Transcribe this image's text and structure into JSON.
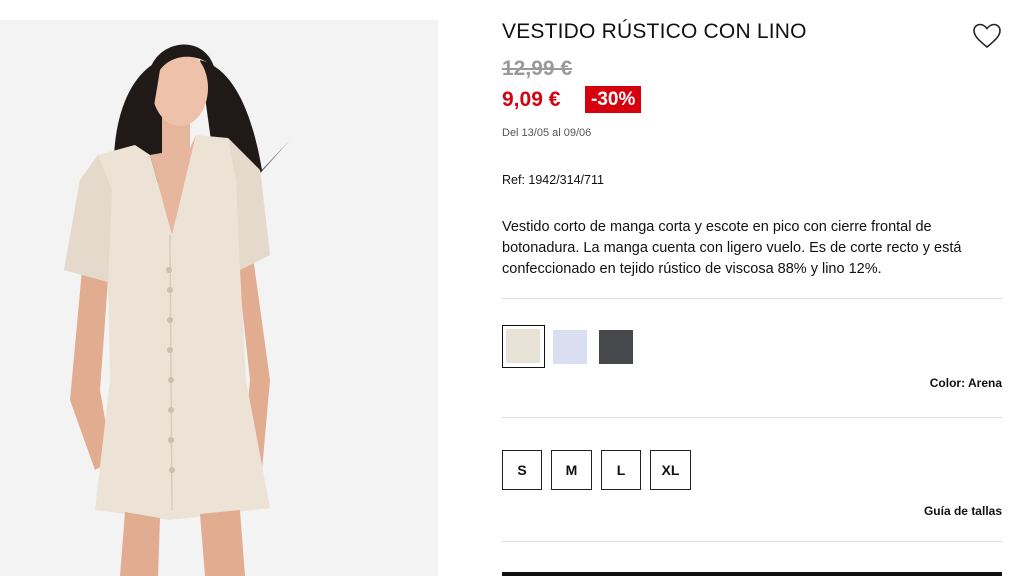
{
  "product": {
    "title": "VESTIDO RÚSTICO CON LINO",
    "old_price": "12,99 €",
    "new_price": "9,09 €",
    "discount": "-30%",
    "delivery": "Del 13/05 al 09/06",
    "reference": "Ref: 1942/314/711",
    "description": "Vestido corto de manga corta y escote en pico con cierre frontal de botonadura. La manga cuenta con ligero vuelo. Es de corte recto y está confeccionado en tejido rústico de viscosa 88% y lino 12%."
  },
  "icons": {
    "wishlist": "heart-outline-icon"
  },
  "colors": {
    "price_red": "#d7000f",
    "swatches": [
      "#e9e2d6",
      "#d9def0",
      "#47484c"
    ],
    "selected_index": 0
  },
  "color_label": "Color: Arena",
  "sizes": [
    "S",
    "M",
    "L",
    "XL"
  ],
  "size_guide": "Guía de tallas"
}
